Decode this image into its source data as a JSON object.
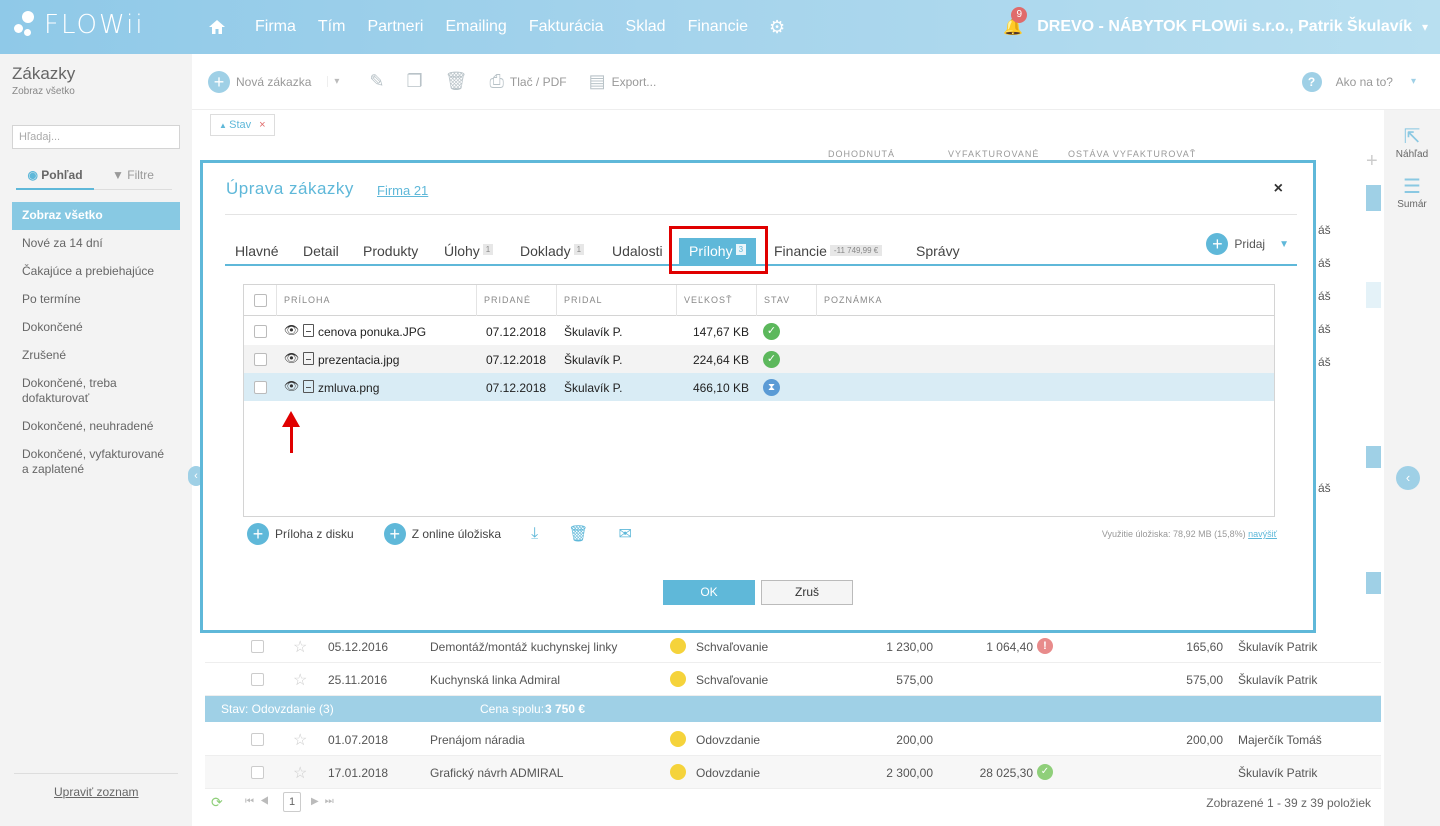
{
  "app": {
    "logo_text": "FLOWii"
  },
  "nav": {
    "items": [
      "Firma",
      "Tím",
      "Partneri",
      "Emailing",
      "Fakturácia",
      "Sklad",
      "Financie"
    ],
    "notifications": "9",
    "account": "DREVO - NÁBYTOK FLOWii s.r.o., Patrik Škulavík"
  },
  "sidebar": {
    "title": "Zákazky",
    "subtitle": "Zobraz všetko",
    "search_placeholder": "Hľadaj...",
    "view_tab": "Pohľad",
    "filter_tab": "Filtre",
    "items": [
      "Zobraz všetko",
      "Nové za 14 dní",
      "Čakajúce a prebiehajúce",
      "Po termíne",
      "Dokončené",
      "Zrušené",
      "Dokončené, treba dofakturovať",
      "Dokončené, neuhradené",
      "Dokončené, vyfakturované a zaplatené"
    ],
    "edit_list": "Upraviť zoznam"
  },
  "toolbar": {
    "new_order": "Nová zákazka",
    "print": "Tlač / PDF",
    "export": "Export...",
    "help": "Ako na to?"
  },
  "rail": {
    "preview": "Náhľad",
    "summary": "Sumár"
  },
  "list": {
    "filter_chip": "Stav",
    "col_agreed": "DOHODNUTÁ",
    "col_invoiced": "VYFAKTUROVANÉ",
    "col_remaining": "OSTÁVA VYFAKTUROVAŤ",
    "right_names": [
      "áš",
      "áš",
      "áš",
      "áš",
      "áš",
      "áš"
    ],
    "rows": [
      {
        "date": "05.12.2016",
        "name": "Demontáž/montáž kuchynskej linky",
        "status": "Schvaľovanie",
        "agreed": "1 230,00",
        "invoiced": "1 064,40",
        "remaining": "165,60",
        "owner": "Škulavík Patrik"
      },
      {
        "date": "25.11.2016",
        "name": "Kuchynská linka Admiral",
        "status": "Schvaľovanie",
        "agreed": "575,00",
        "invoiced": "",
        "remaining": "575,00",
        "owner": "Škulavík Patrik"
      }
    ],
    "group_label": "Stav: Odovzdanie (3)",
    "group_total_label": "Cena spolu:",
    "group_total_value": "3 750 €",
    "rows2": [
      {
        "date": "01.07.2018",
        "name": "Prenájom náradia",
        "status": "Odovzdanie",
        "agreed": "200,00",
        "invoiced": "",
        "remaining": "200,00",
        "owner": "Majerčík Tomáš"
      },
      {
        "date": "17.01.2018",
        "name": "Grafický návrh ADMIRAL",
        "status": "Odovzdanie",
        "agreed": "2 300,00",
        "invoiced": "28 025,30",
        "remaining": "",
        "owner": "Škulavík Patrik"
      }
    ],
    "page": "1",
    "count_text": "Zobrazené 1 - 39 z 39 položiek"
  },
  "modal": {
    "title": "Úprava zákazky",
    "company_link": "Firma 21",
    "close": "×",
    "tabs": [
      {
        "label": "Hlavné",
        "count": ""
      },
      {
        "label": "Detail",
        "count": ""
      },
      {
        "label": "Produkty",
        "count": ""
      },
      {
        "label": "Úlohy",
        "count": "1"
      },
      {
        "label": "Doklady",
        "count": "1"
      },
      {
        "label": "Udalosti",
        "count": ""
      },
      {
        "label": "Prílohy",
        "count": "3"
      },
      {
        "label": "Financie",
        "count": "-11 749,99 €"
      },
      {
        "label": "Správy",
        "count": ""
      }
    ],
    "add_label": "Pridaj",
    "columns": [
      "PRÍLOHA",
      "PRIDANÉ",
      "PRIDAL",
      "VEĽKOSŤ",
      "STAV",
      "POZNÁMKA"
    ],
    "attachments": [
      {
        "name": "cenova ponuka.JPG",
        "added": "07.12.2018",
        "by": "Škulavík P.",
        "size": "147,67 KB",
        "status": "ok"
      },
      {
        "name": "prezentacia.jpg",
        "added": "07.12.2018",
        "by": "Škulavík P.",
        "size": "224,64 KB",
        "status": "ok"
      },
      {
        "name": "zmluva.png",
        "added": "07.12.2018",
        "by": "Škulavík P.",
        "size": "466,10 KB",
        "status": "pending"
      }
    ],
    "add_from_disk": "Príloha z disku",
    "add_from_cloud": "Z online úložiska",
    "storage_text": "Využitie úložiska: 78,92 MB (15,8%)",
    "storage_link": "navýšiť",
    "ok": "OK",
    "cancel": "Zruš"
  },
  "colors": {
    "accent": "#5fb8d9",
    "highlight": "#e00000",
    "ok": "#5cb85c",
    "pending": "#5b9bd5"
  }
}
